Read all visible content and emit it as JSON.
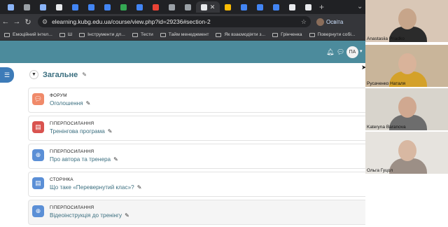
{
  "browser": {
    "tabs": [
      {
        "color": "#8ab4f8"
      },
      {
        "color": "#9aa0a6"
      },
      {
        "color": "#8ab4f8"
      },
      {
        "color": "#e8eaed"
      },
      {
        "color": "#4285f4"
      },
      {
        "color": "#4285f4"
      },
      {
        "color": "#4285f4"
      },
      {
        "color": "#34a853"
      },
      {
        "color": "#4285f4"
      },
      {
        "color": "#ea4335"
      },
      {
        "color": "#9aa0a6"
      },
      {
        "color": "#9aa0a6"
      },
      {
        "color": "#e8eaed",
        "active": true
      },
      {
        "color": "#fbbc04"
      },
      {
        "color": "#4285f4"
      },
      {
        "color": "#4285f4"
      },
      {
        "color": "#4285f4"
      },
      {
        "color": "#e8eaed"
      },
      {
        "color": "#e8eaed"
      }
    ],
    "url": "elearning.kubg.edu.ua/course/view.php?id=29236#section-2",
    "profile_label": "Освіта",
    "bookmarks": [
      "Емоційний інтел...",
      "Ш",
      "Інструменти дл...",
      "Тести",
      "Тайм менеджмент",
      "Як взаємодіяти з...",
      "Грінченка",
      "Повернути собі..."
    ]
  },
  "moodle": {
    "user_initials": "ПА",
    "section_title": "Загальне",
    "activities": [
      {
        "type": "ФОРУМ",
        "name": "Оголошення",
        "icon": "forum-icon",
        "icon_color": "#f08a6a"
      },
      {
        "type": "ГІПЕРПОСИЛАННЯ",
        "name": "Тренінгова програма",
        "icon": "pdf-icon",
        "icon_color": "#d9534f"
      },
      {
        "type": "ГІПЕРПОСИЛАННЯ",
        "name": "Про автора та тренера",
        "icon": "globe-icon",
        "icon_color": "#5b8fd6"
      },
      {
        "type": "СТОРІНКА",
        "name": "Що таке «Перевернутий клас»?",
        "icon": "page-icon",
        "icon_color": "#5b8fd6"
      },
      {
        "type": "ГІПЕРПОСИЛАННЯ",
        "name": "Відеоінструкція до тренінгу",
        "icon": "globe-icon",
        "icon_color": "#5b8fd6"
      }
    ]
  },
  "participants": [
    {
      "name": "Anastasiia Priadko",
      "bg": "#d9c7b6",
      "head": "#c7a58a",
      "body": "#2b2b2b"
    },
    {
      "name": "Русаченко Наталя",
      "bg": "#c9b59a",
      "head": "#d9b39a",
      "body": "#d4a12a"
    },
    {
      "name": "Kateryna Baranova",
      "bg": "#d8d4cc",
      "head": "#d0a890",
      "body": "#6d6d6d"
    },
    {
      "name": "Ольга Гуцол",
      "bg": "#e6e3de",
      "head": "#d8b8a2",
      "body": "#9c8f86"
    }
  ]
}
